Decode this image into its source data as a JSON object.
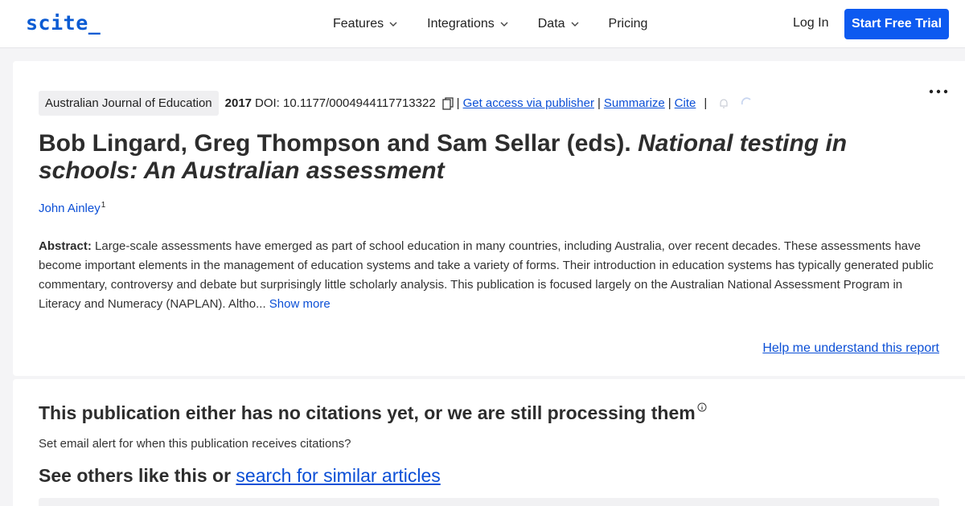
{
  "nav": {
    "logo": "scite_",
    "items": [
      {
        "label": "Features",
        "has_dropdown": true
      },
      {
        "label": "Integrations",
        "has_dropdown": true
      },
      {
        "label": "Data",
        "has_dropdown": true
      },
      {
        "label": "Pricing",
        "has_dropdown": false
      }
    ],
    "login": "Log In",
    "cta": "Start Free Trial"
  },
  "article": {
    "journal": "Australian Journal of Education",
    "year": "2017",
    "doi": "DOI: 10.1177/0004944117713322",
    "actions": {
      "access": "Get access via publisher",
      "summarize": "Summarize",
      "cite": "Cite"
    },
    "title_plain": "Bob Lingard, Greg Thompson and Sam Sellar (eds). ",
    "title_italic": "National testing in schools: An Australian assessment",
    "author": "John Ainley",
    "author_affiliation": "1",
    "abstract_label": "Abstract:",
    "abstract": " Large-scale assessments have emerged as part of school education in many countries, including Australia, over recent decades. These assessments have become important elements in the management of education systems and take a variety of forms. Their introduction in education systems has typically generated public commentary, controversy and debate but surprisingly little scholarly analysis. This publication is focused largely on the Australian National Assessment Program in Literacy and Numeracy (NAPLAN). Altho...",
    "show_more": " Show more",
    "help": "Help me understand this report"
  },
  "citations": {
    "heading": "This publication either has no citations yet, or we are still processing them",
    "alert": "Set email alert for when this publication receives citations?",
    "others_prefix": "See others like this or ",
    "others_link": "search for similar articles"
  },
  "colors": {
    "brand": "#0b5bd3",
    "cta": "#0d5af0",
    "link": "#0b4fd6"
  }
}
